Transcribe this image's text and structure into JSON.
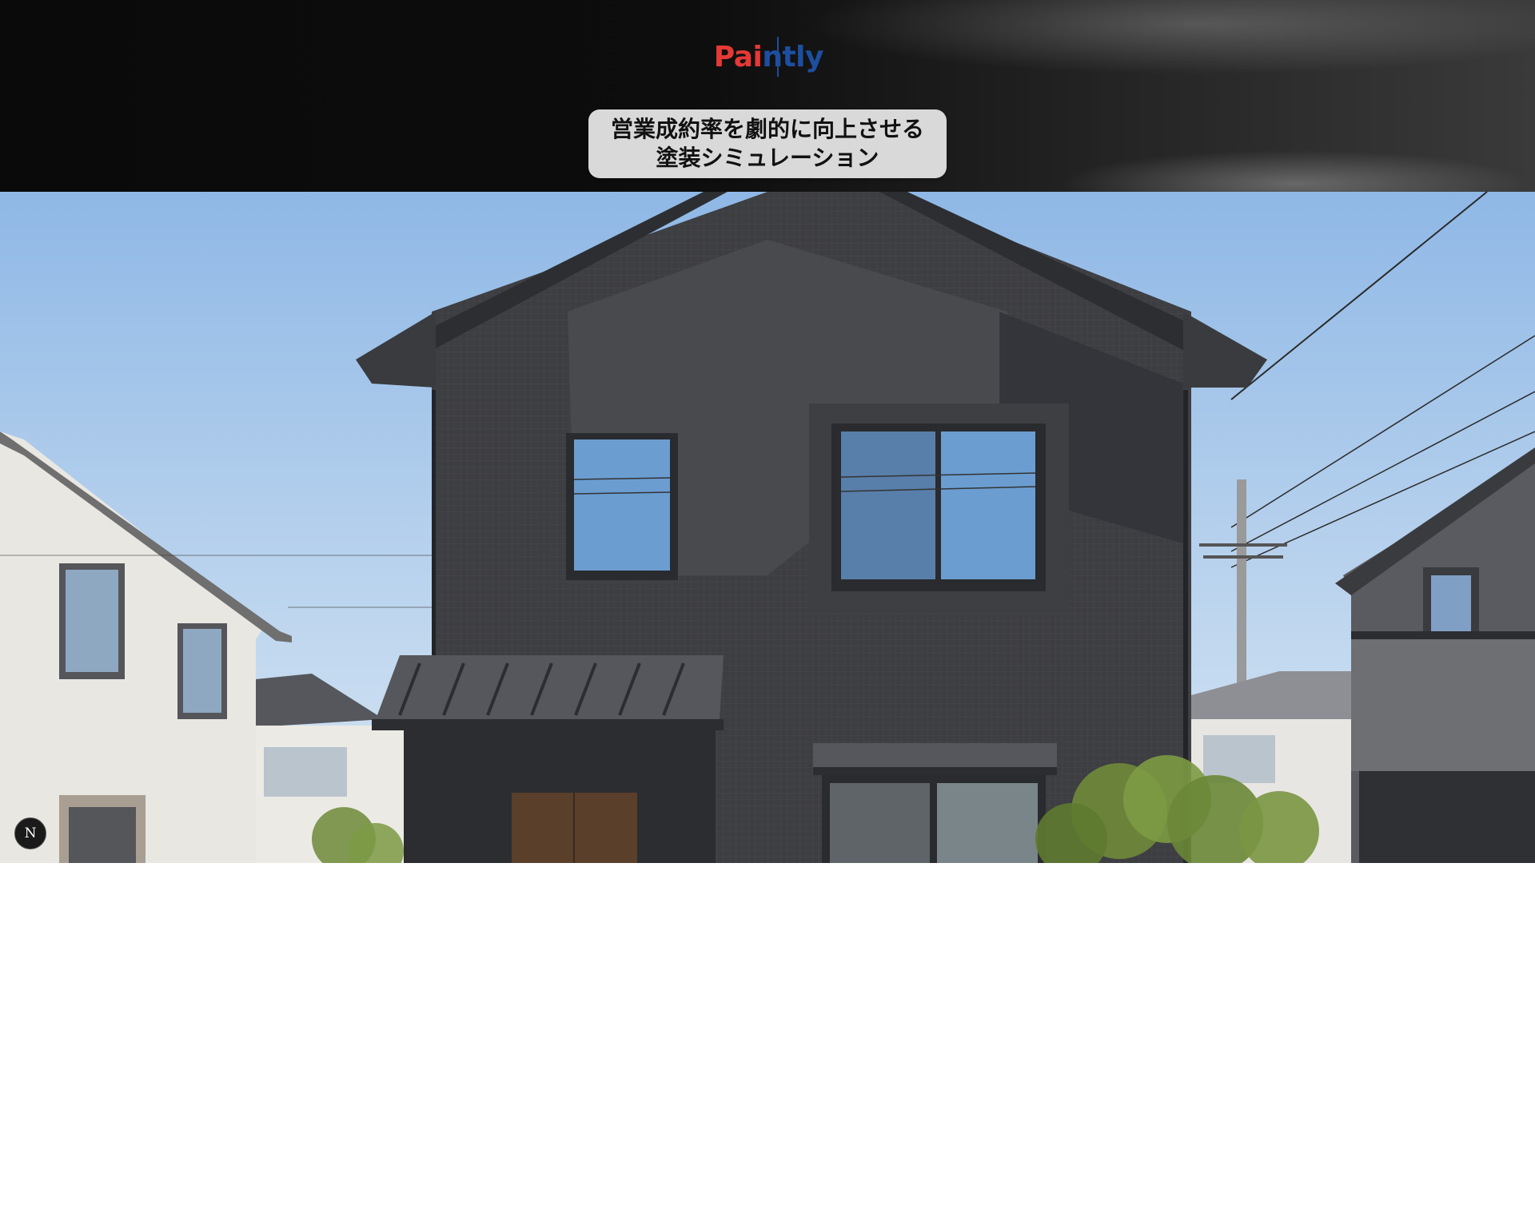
{
  "header": {
    "logo": {
      "part1": "Pai",
      "part2": "ntly"
    },
    "tagline": {
      "line1": "営業成約率を劇的に向上させる",
      "line2": "塗装シミュレーション"
    }
  },
  "hero": {
    "image_subject": "house-photo"
  },
  "badge": {
    "label": "N"
  },
  "colors": {
    "brand_red": "#e53935",
    "brand_blue": "#1d4fa0",
    "header_bg": "#0d0d0d",
    "tagline_bg": "#d9d9d9"
  }
}
